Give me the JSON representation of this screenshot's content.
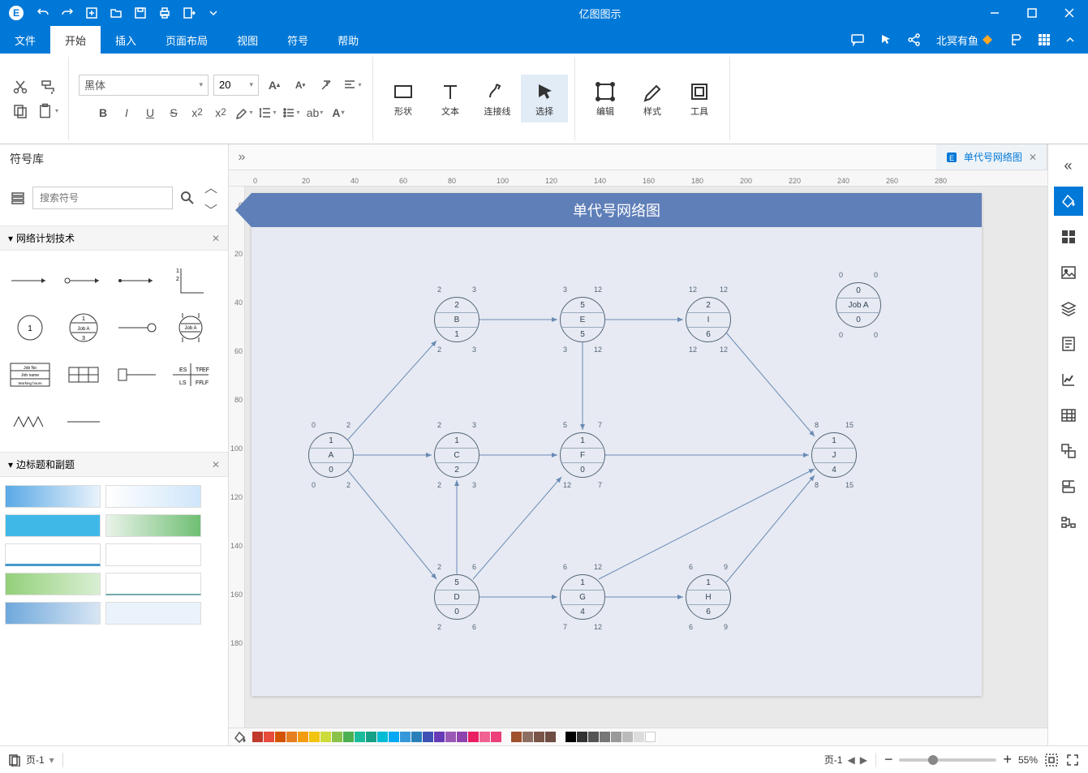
{
  "title": "亿图图示",
  "menubar": [
    "文件",
    "开始",
    "插入",
    "页面布局",
    "视图",
    "符号",
    "帮助"
  ],
  "active_menu": 1,
  "right_tools": {
    "beiyu": "北冥有鱼"
  },
  "ribbon": {
    "font_name": "黑体",
    "font_size": "20",
    "groups": [
      "形状",
      "文本",
      "连接线",
      "选择",
      "编辑",
      "样式",
      "工具"
    ]
  },
  "sidepanel": {
    "title": "符号库",
    "search_ph": "搜索符号",
    "lib1": "网络计划技术",
    "lib2": "边标题和副题"
  },
  "doc_tab": "单代号网络图",
  "canvas_title": "单代号网络图",
  "ruler_h": [
    "0",
    "20",
    "40",
    "60",
    "80",
    "100",
    "120",
    "140",
    "160",
    "180",
    "200",
    "220",
    "240",
    "260",
    "280"
  ],
  "ruler_v": [
    "0",
    "20",
    "40",
    "60",
    "80",
    "100",
    "120",
    "140",
    "160",
    "180"
  ],
  "nodes": {
    "A": {
      "top": "1",
      "mid": "A",
      "bot": "0",
      "tl": "0",
      "tr": "2",
      "bl": "0",
      "br": "2"
    },
    "C": {
      "top": "1",
      "mid": "C",
      "bot": "2",
      "tl": "2",
      "tr": "3",
      "bl": "2",
      "br": "3"
    },
    "F": {
      "top": "1",
      "mid": "F",
      "bot": "0",
      "tl": "5",
      "tr": "7",
      "bl": "12",
      "br": "7"
    },
    "J": {
      "top": "1",
      "mid": "J",
      "bot": "4",
      "tl": "8",
      "tr": "15",
      "bl": "8",
      "br": "15"
    },
    "B": {
      "top": "2",
      "mid": "B",
      "bot": "1",
      "tl": "2",
      "tr": "3",
      "bl": "2",
      "br": "3"
    },
    "E": {
      "top": "5",
      "mid": "E",
      "bot": "5",
      "tl": "3",
      "tr": "12",
      "bl": "3",
      "br": "12"
    },
    "I": {
      "top": "2",
      "mid": "I",
      "bot": "6",
      "tl": "12",
      "tr": "12",
      "bl": "12",
      "br": "12"
    },
    "JobA": {
      "top": "0",
      "mid": "Job A",
      "bot": "0",
      "tl": "0",
      "tr": "0",
      "bl": "0",
      "br": "0"
    },
    "D": {
      "top": "5",
      "mid": "D",
      "bot": "0",
      "tl": "2",
      "tr": "6",
      "bl": "2",
      "br": "6"
    },
    "G": {
      "top": "1",
      "mid": "G",
      "bot": "4",
      "tl": "6",
      "tr": "12",
      "bl": "7",
      "br": "12"
    },
    "H": {
      "top": "1",
      "mid": "H",
      "bot": "6",
      "tl": "6",
      "tr": "9",
      "bl": "6",
      "br": "9"
    }
  },
  "status": {
    "page_left": "页-1",
    "page_right": "页-1",
    "zoom": "55%"
  }
}
